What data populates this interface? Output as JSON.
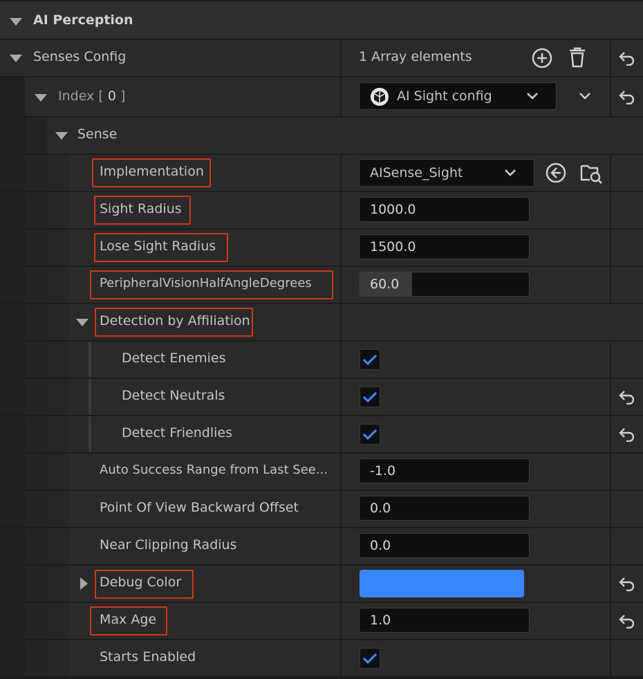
{
  "header": {
    "title": "AI Perception"
  },
  "senses_config": {
    "label": "Senses Config",
    "value": "1 Array elements"
  },
  "index": {
    "label": "Index [ ",
    "num": "0",
    "suffix": " ]",
    "selected": "AI Sight config"
  },
  "sense": {
    "label": "Sense"
  },
  "implementation": {
    "label": "Implementation",
    "value": "AISense_Sight"
  },
  "sight_radius": {
    "label": "Sight Radius",
    "value": "1000.0"
  },
  "lose_sight_radius": {
    "label": "Lose Sight Radius",
    "value": "1500.0"
  },
  "peripheral": {
    "label": "PeripheralVisionHalfAngleDegrees",
    "value": "60.0"
  },
  "detection": {
    "label": "Detection by Affiliation",
    "enemies": "Detect Enemies",
    "neutrals": "Detect Neutrals",
    "friendlies": "Detect Friendlies"
  },
  "auto_success": {
    "label": "Auto Success Range from Last See...",
    "value": "-1.0"
  },
  "pov_offset": {
    "label": "Point Of View Backward Offset",
    "value": "0.0"
  },
  "near_clip": {
    "label": "Near Clipping Radius",
    "value": "0.0"
  },
  "debug_color": {
    "label": "Debug Color",
    "color": "#3a86ff"
  },
  "max_age": {
    "label": "Max Age",
    "value": "1.0"
  },
  "starts_enabled": {
    "label": "Starts Enabled"
  },
  "colors": {
    "highlight": "#d0361c",
    "check": "#3a86ff"
  }
}
